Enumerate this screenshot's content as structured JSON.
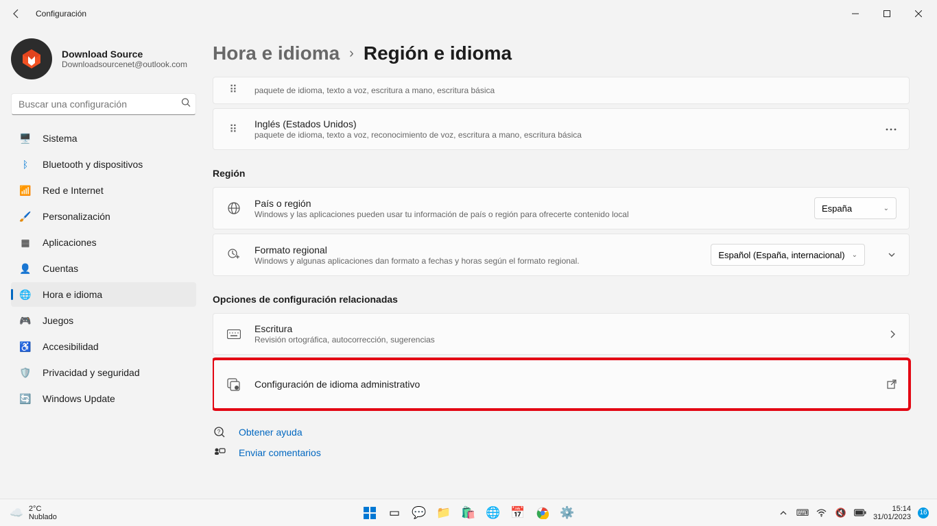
{
  "window": {
    "title": "Configuración"
  },
  "user": {
    "name": "Download Source",
    "email": "Downloadsourcenet@outlook.com"
  },
  "search": {
    "placeholder": "Buscar una configuración"
  },
  "nav": {
    "system": "Sistema",
    "bluetooth": "Bluetooth y dispositivos",
    "network": "Red e Internet",
    "personalization": "Personalización",
    "apps": "Aplicaciones",
    "accounts": "Cuentas",
    "time_lang": "Hora e idioma",
    "gaming": "Juegos",
    "accessibility": "Accesibilidad",
    "privacy": "Privacidad y seguridad",
    "update": "Windows Update"
  },
  "breadcrumb": {
    "parent": "Hora e idioma",
    "current": "Región e idioma"
  },
  "languages": {
    "item0_sub": "paquete de idioma, texto a voz, escritura a mano, escritura básica",
    "item1_title": "Inglés (Estados Unidos)",
    "item1_sub": "paquete de idioma, texto a voz, reconocimiento de voz, escritura a mano, escritura básica"
  },
  "sections": {
    "region": "Región",
    "related": "Opciones de configuración relacionadas"
  },
  "region": {
    "country_title": "País o región",
    "country_sub": "Windows y las aplicaciones pueden usar tu información de país o región para ofrecerte contenido local",
    "country_value": "España",
    "format_title": "Formato regional",
    "format_sub": "Windows y algunas aplicaciones dan formato a fechas y horas según el formato regional.",
    "format_value": "Español (España, internacional)"
  },
  "related": {
    "typing_title": "Escritura",
    "typing_sub": "Revisión ortográfica, autocorrección, sugerencias",
    "admin_title": "Configuración de idioma administrativo"
  },
  "help": {
    "get_help": "Obtener ayuda",
    "feedback": "Enviar comentarios"
  },
  "taskbar": {
    "weather_temp": "2°C",
    "weather_desc": "Nublado",
    "time": "15:14",
    "date": "31/01/2023",
    "notif_count": "16"
  }
}
